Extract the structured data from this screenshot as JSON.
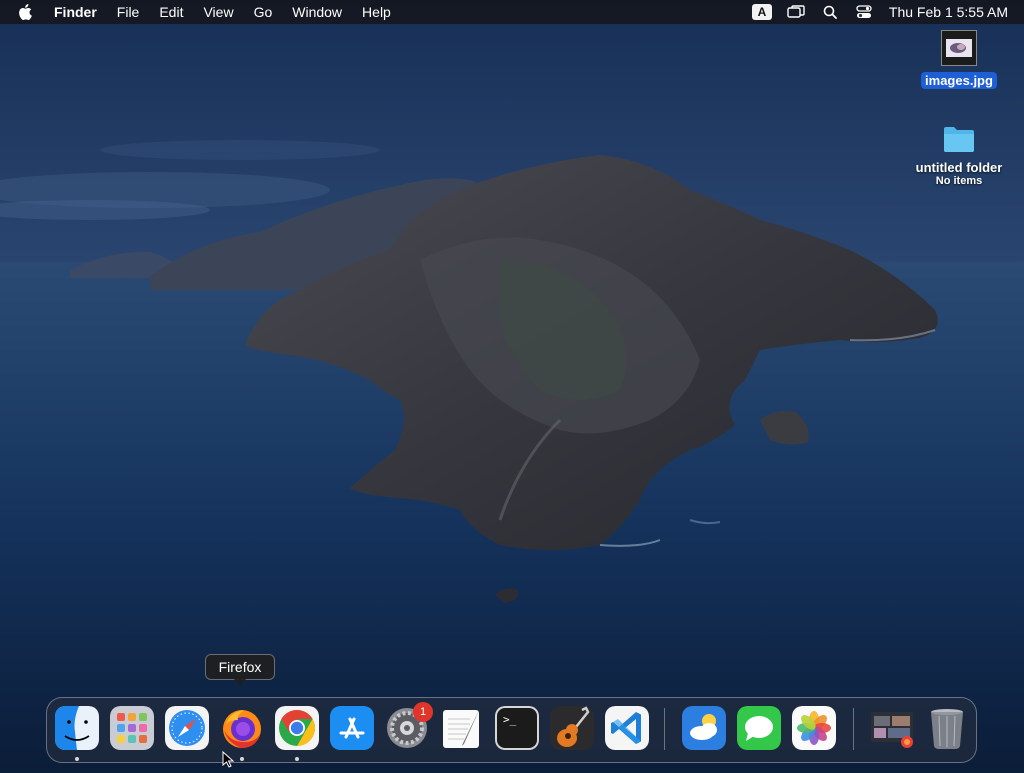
{
  "menubar": {
    "app_name": "Finder",
    "menus": [
      "File",
      "Edit",
      "View",
      "Go",
      "Window",
      "Help"
    ],
    "input_source": "A",
    "clock": "Thu Feb 1  5:55 AM",
    "icons": [
      "apple-icon",
      "input-source-icon",
      "screen-mirroring-icon",
      "spotlight-search-icon",
      "control-center-icon"
    ]
  },
  "desktop": {
    "file": {
      "label": "images.jpg",
      "selected": true
    },
    "folder": {
      "label": "untitled folder",
      "sublabel": "No items"
    }
  },
  "tooltip": {
    "text": "Firefox"
  },
  "dock": {
    "apps": [
      {
        "name": "Finder",
        "icon": "finder-icon",
        "running": true
      },
      {
        "name": "Launchpad",
        "icon": "launchpad-icon",
        "running": false
      },
      {
        "name": "Safari",
        "icon": "safari-icon",
        "running": false
      },
      {
        "name": "Firefox",
        "icon": "firefox-icon",
        "running": true
      },
      {
        "name": "Google Chrome",
        "icon": "chrome-icon",
        "running": true
      },
      {
        "name": "App Store",
        "icon": "app-store-icon",
        "running": false
      },
      {
        "name": "System Settings",
        "icon": "system-settings-icon",
        "running": false,
        "badge": "1"
      },
      {
        "name": "TextEdit",
        "icon": "textedit-icon",
        "running": false
      },
      {
        "name": "Terminal",
        "icon": "terminal-icon",
        "running": false
      },
      {
        "name": "GarageBand",
        "icon": "garageband-icon",
        "running": false
      },
      {
        "name": "Visual Studio Code",
        "icon": "vscode-icon",
        "running": false
      },
      {
        "name": "Weather",
        "icon": "weather-icon",
        "running": false
      },
      {
        "name": "Messages",
        "icon": "messages-icon",
        "running": false
      },
      {
        "name": "Photos",
        "icon": "photos-icon",
        "running": false
      },
      {
        "name": "Downloads",
        "icon": "downloads-stack-icon",
        "running": false
      },
      {
        "name": "Trash",
        "icon": "trash-icon",
        "running": false
      }
    ],
    "terminal_prompt": ">_",
    "settings_badge": "1"
  },
  "colors": {
    "selection": "#1f5fd6",
    "badge": "#e0352b",
    "menubar": "#14161c"
  }
}
